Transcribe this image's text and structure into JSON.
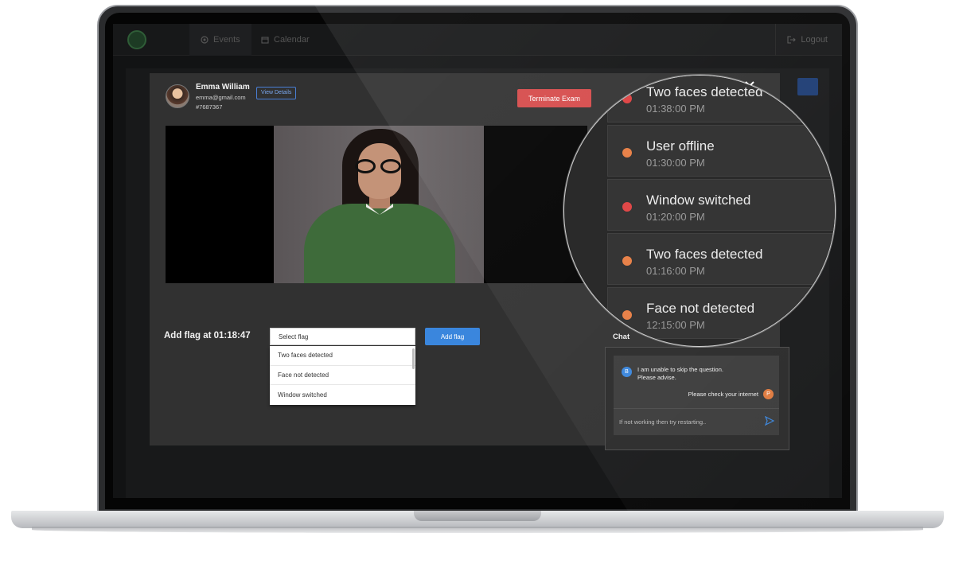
{
  "nav": {
    "tabs": [
      {
        "label": "Events",
        "icon": "circle-dot-icon"
      },
      {
        "label": "Calendar",
        "icon": "calendar-icon"
      }
    ],
    "logout_label": "Logout"
  },
  "modal": {
    "user": {
      "name": "Emma William",
      "email": "emma@gmail.com",
      "id": "#7687367",
      "view_details_label": "View Details"
    },
    "terminate_label": "Terminate Exam",
    "add_flag": {
      "label": "Add flag at 01:18:47",
      "select_placeholder": "Select flag",
      "options": [
        "Two faces detected",
        "Face not detected",
        "Window switched"
      ],
      "button_label": "Add flag"
    },
    "chat": {
      "title": "Chat",
      "messages": [
        {
          "avatar": "B",
          "line1": "I am unable to skip the question.",
          "line2": "Please advise."
        },
        {
          "avatar": "P",
          "text": "Please check your internet"
        }
      ],
      "input_text": "If not working then try restarting.."
    }
  },
  "events": [
    {
      "title": "Two faces detected",
      "time": "01:38:00 PM",
      "severity": "red"
    },
    {
      "title": "User offline",
      "time": "01:30:00 PM",
      "severity": "orange"
    },
    {
      "title": "Window switched",
      "time": "01:20:00 PM",
      "severity": "red"
    },
    {
      "title": "Two faces detected",
      "time": "01:16:00 PM",
      "severity": "orange"
    },
    {
      "title": "Face not detected",
      "time": "12:15:00 PM",
      "severity": "orange"
    }
  ],
  "colors": {
    "red": "#e04848",
    "orange": "#e8824a",
    "accent_blue": "#3a86dd",
    "terminate_red": "#d64b4b",
    "avatar_blue": "#3a86dd",
    "avatar_orange": "#e07a3e"
  }
}
